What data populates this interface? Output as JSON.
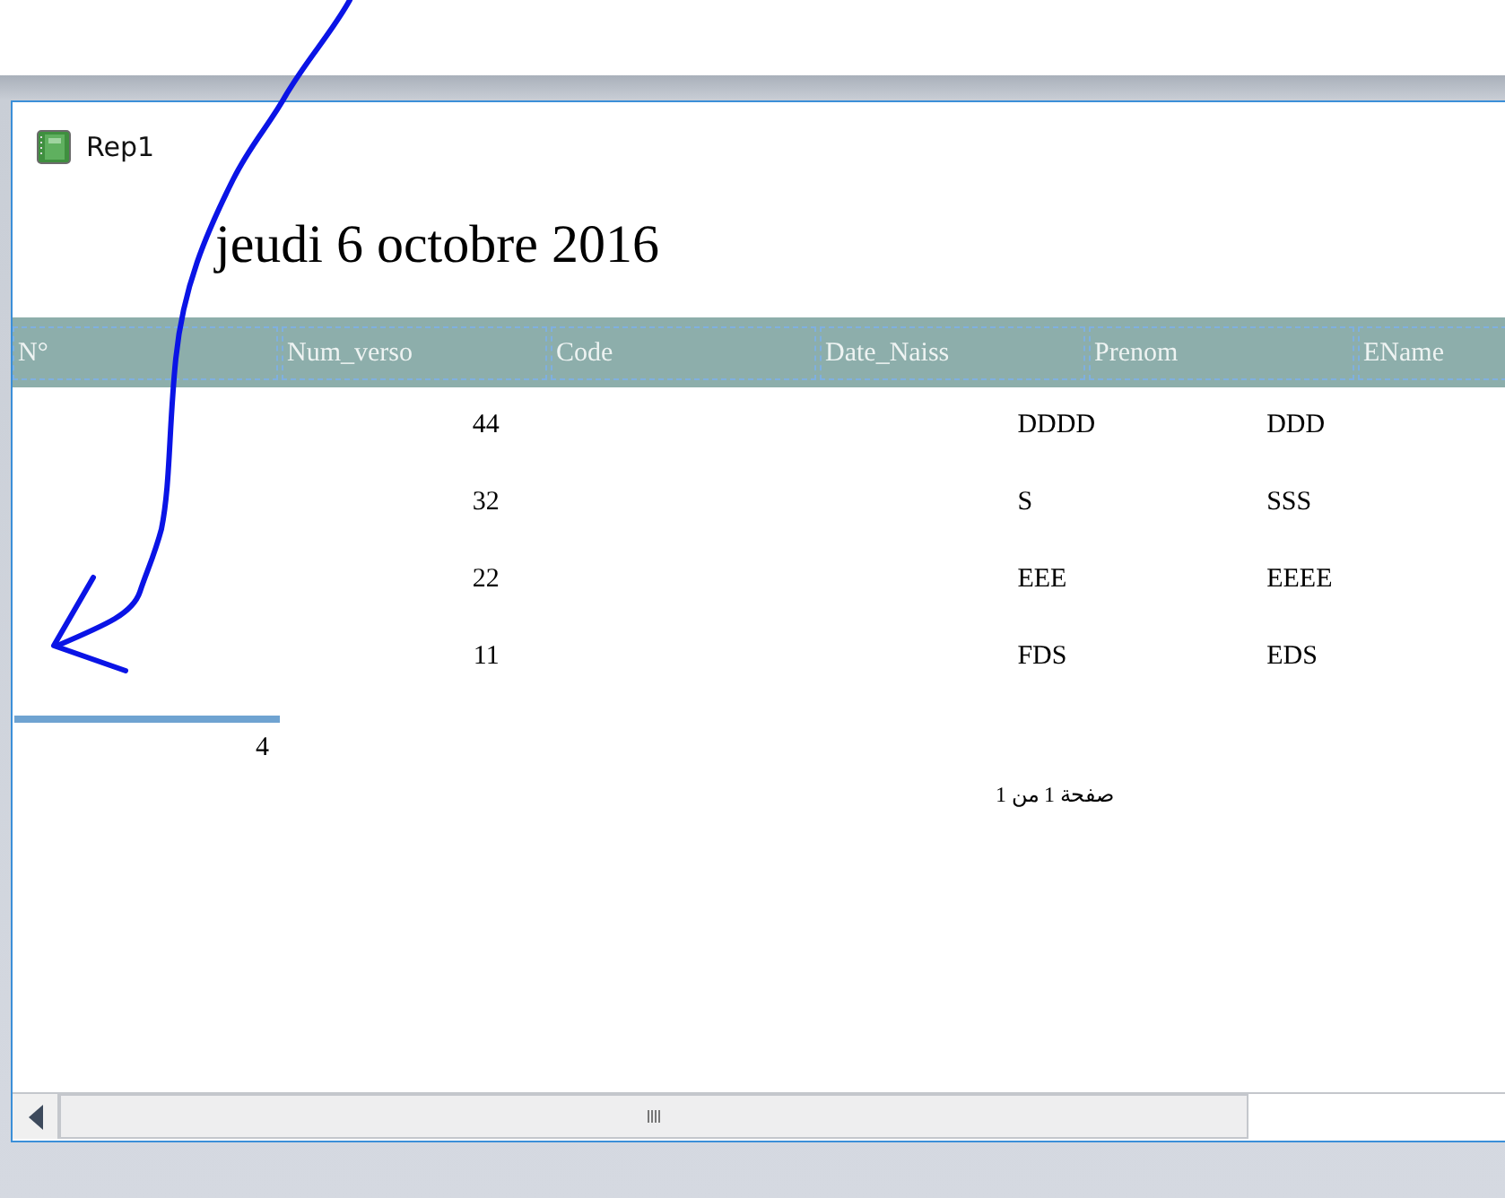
{
  "window": {
    "title": "Rep1"
  },
  "report": {
    "date": "jeudi 6 octobre 2016"
  },
  "table": {
    "columns": [
      "N°",
      "Num_verso",
      "Code",
      "Date_Naiss",
      "Prenom",
      "EName"
    ],
    "rows": [
      {
        "num_verso": "44",
        "prenom": "DDDD",
        "ename": "DDD"
      },
      {
        "num_verso": "32",
        "prenom": "S",
        "ename": "SSS"
      },
      {
        "num_verso": "22",
        "prenom": "EEE",
        "ename": "EEEE"
      },
      {
        "num_verso": "11",
        "prenom": "FDS",
        "ename": "EDS"
      }
    ],
    "total": "4"
  },
  "page_footer": "صفحة 1 من 1"
}
